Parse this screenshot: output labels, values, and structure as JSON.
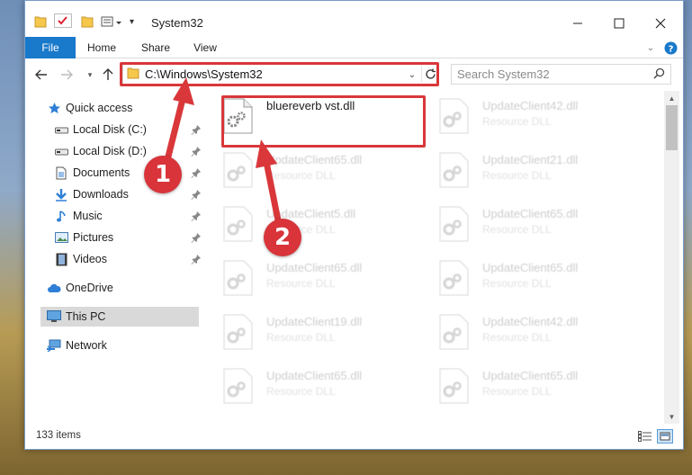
{
  "titlebar": {
    "title": "System32"
  },
  "ribbon": {
    "tabs": [
      "File",
      "Home",
      "Share",
      "View"
    ]
  },
  "navbar": {
    "address": "C:\\Windows\\System32",
    "search_placeholder": "Search System32"
  },
  "sidebar": {
    "items": [
      {
        "label": "Quick access",
        "icon": "star-icon"
      },
      {
        "label": "Local Disk (C:)",
        "icon": "drive-icon"
      },
      {
        "label": "Local Disk (D:)",
        "icon": "drive-icon"
      },
      {
        "label": "Documents",
        "icon": "documents-icon"
      },
      {
        "label": "Downloads",
        "icon": "download-icon"
      },
      {
        "label": "Music",
        "icon": "music-icon"
      },
      {
        "label": "Pictures",
        "icon": "pictures-icon"
      },
      {
        "label": "Videos",
        "icon": "videos-icon"
      },
      {
        "label": "OneDrive",
        "icon": "cloud-icon"
      },
      {
        "label": "This PC",
        "icon": "computer-icon"
      },
      {
        "label": "Network",
        "icon": "network-icon"
      }
    ]
  },
  "files": [
    {
      "name": "bluereverb vst.dll",
      "type": ""
    },
    {
      "name": "UpdateClient42.dll",
      "type": "Resource DLL"
    },
    {
      "name": "UpdateClient65.dll",
      "type": "Resource DLL"
    },
    {
      "name": "UpdateClient21.dll",
      "type": "Resource DLL"
    },
    {
      "name": "UpdateClient5.dll",
      "type": "Resource DLL"
    },
    {
      "name": "UpdateClient65.dll",
      "type": "Resource DLL"
    },
    {
      "name": "UpdateClient65.dll",
      "type": "Resource DLL"
    },
    {
      "name": "UpdateClient65.dll",
      "type": "Resource DLL"
    },
    {
      "name": "UpdateClient19.dll",
      "type": "Resource DLL"
    },
    {
      "name": "UpdateClient42.dll",
      "type": "Resource DLL"
    },
    {
      "name": "UpdateClient65.dll",
      "type": "Resource DLL"
    },
    {
      "name": "UpdateClient65.dll",
      "type": "Resource DLL"
    }
  ],
  "status": {
    "item_count": "133 items"
  },
  "annotations": {
    "badge1": "1",
    "badge2": "2",
    "color": "#d9373a"
  },
  "colors": {
    "file_tab": "#1979ca",
    "selected_nav": "#d9d9d9"
  }
}
